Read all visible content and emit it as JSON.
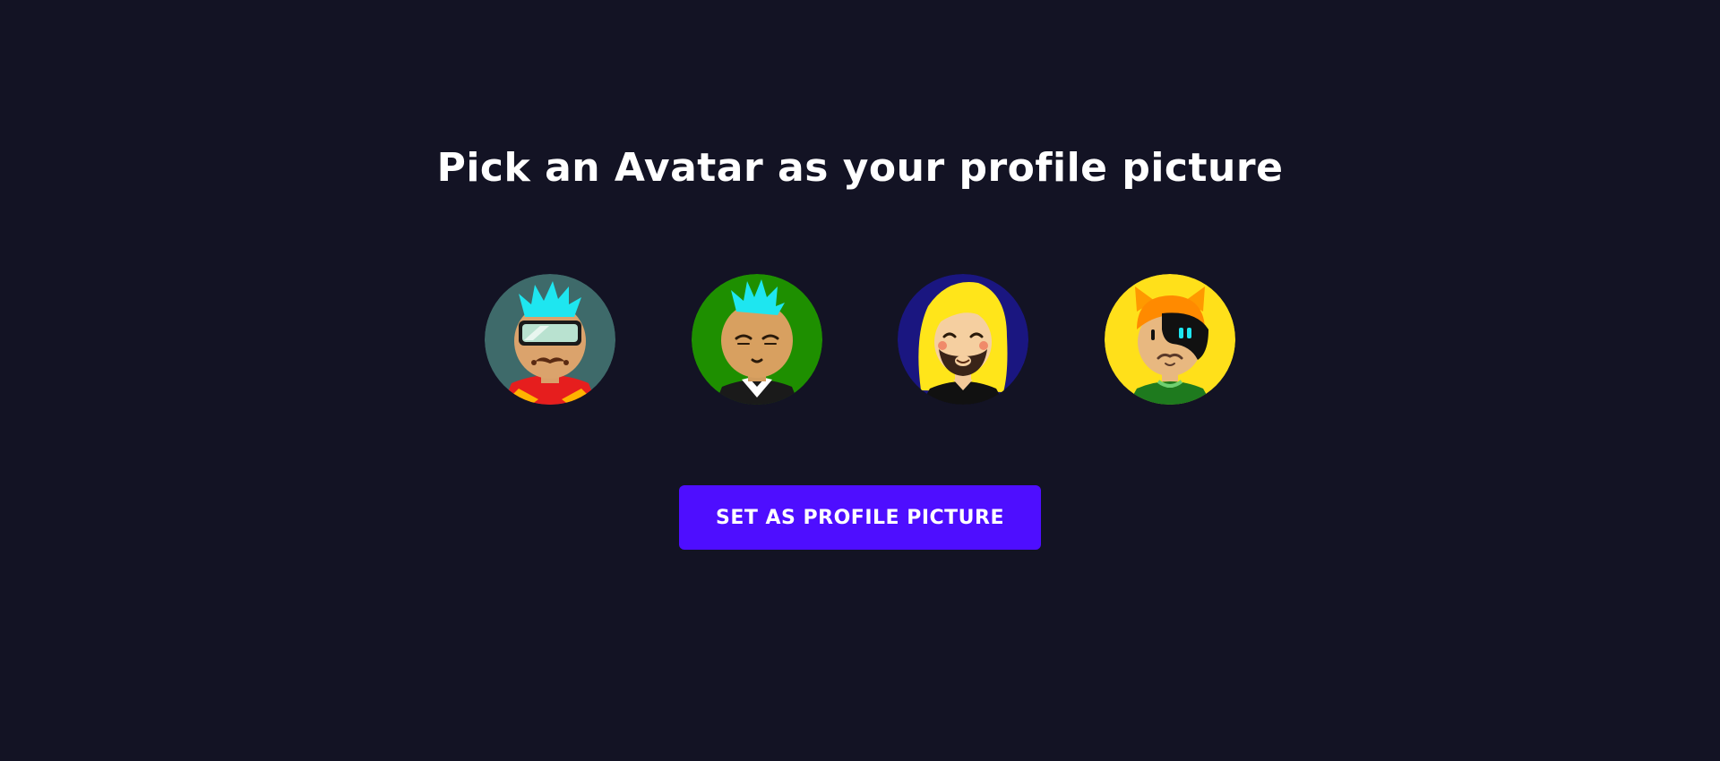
{
  "title": "Pick an Avatar as your profile picture",
  "avatars": [
    {
      "icon": "avatar-cyan-hair-goggles-icon",
      "background": "#3e6a6a"
    },
    {
      "icon": "avatar-cyan-hair-suit-icon",
      "background": "#1e8f00"
    },
    {
      "icon": "avatar-blonde-beard-icon",
      "background": "#1a1680"
    },
    {
      "icon": "avatar-orange-hair-cat-ears-icon",
      "background": "#ffe01a"
    }
  ],
  "button": {
    "label": "SET AS PROFILE PICTURE"
  },
  "colors": {
    "page_background": "#131324",
    "button_background": "#4e0eff",
    "text": "#ffffff"
  }
}
